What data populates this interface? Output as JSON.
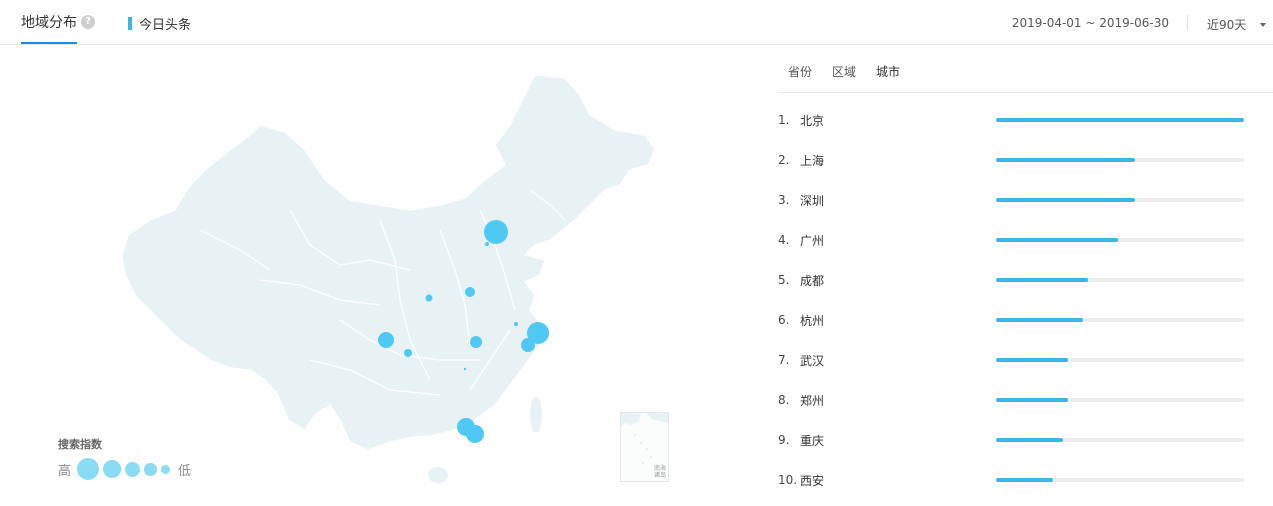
{
  "header": {
    "title": "地域分布",
    "help_icon": "?",
    "source": "今日头条",
    "date_range": "2019-04-01 ~ 2019-06-30",
    "period": "近90天"
  },
  "legend": {
    "title": "搜索指数",
    "high": "高",
    "low": "低"
  },
  "inset": {
    "label_line1": "南海",
    "label_line2": "诸岛"
  },
  "tabs": [
    {
      "label": "省份"
    },
    {
      "label": "区域"
    },
    {
      "label": "城市"
    }
  ],
  "ranking": [
    {
      "rank": "1.",
      "city": "北京",
      "value": 1.0
    },
    {
      "rank": "2.",
      "city": "上海",
      "value": 0.56
    },
    {
      "rank": "3.",
      "city": "深圳",
      "value": 0.56
    },
    {
      "rank": "4.",
      "city": "广州",
      "value": 0.49
    },
    {
      "rank": "5.",
      "city": "成都",
      "value": 0.37
    },
    {
      "rank": "6.",
      "city": "杭州",
      "value": 0.35
    },
    {
      "rank": "7.",
      "city": "武汉",
      "value": 0.29
    },
    {
      "rank": "8.",
      "city": "郑州",
      "value": 0.29
    },
    {
      "rank": "9.",
      "city": "重庆",
      "value": 0.27
    },
    {
      "rank": "10.",
      "city": "西安",
      "value": 0.23
    }
  ],
  "colors": {
    "accent": "#39b5e8",
    "bubble": "#4fc9f4",
    "map_fill": "#e8f1f4",
    "tab_underline": "#1e88e5"
  }
}
